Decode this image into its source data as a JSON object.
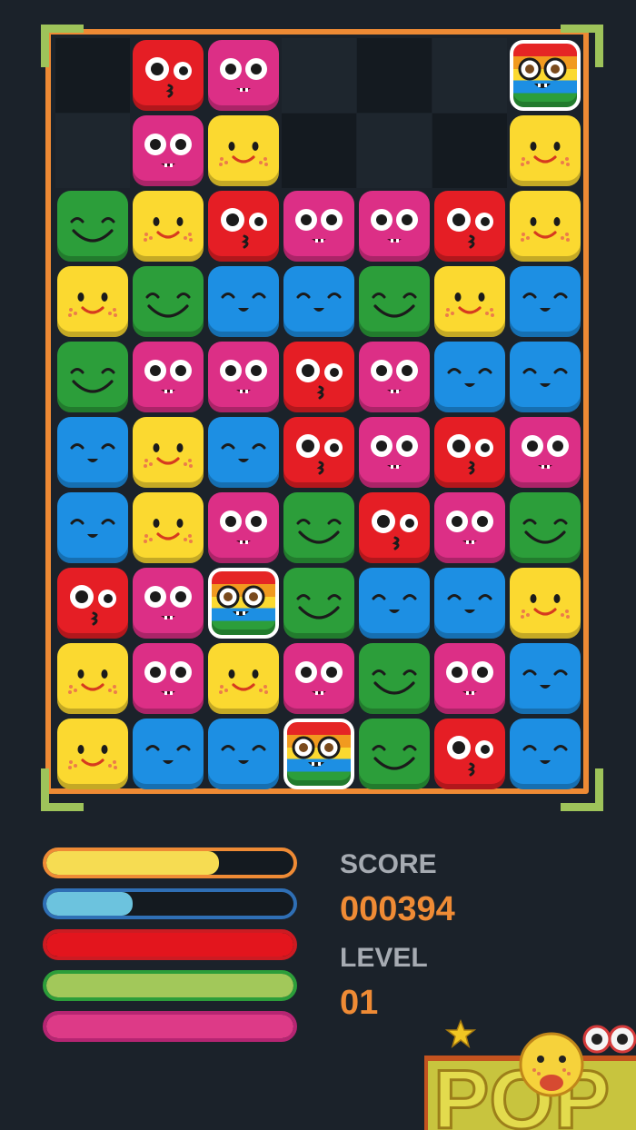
{
  "board": {
    "rows": [
      [
        "empty",
        "red",
        "pink",
        "empty",
        "empty",
        "empty",
        "rainbow"
      ],
      [
        "empty",
        "pink",
        "yellow",
        "empty",
        "empty",
        "empty",
        "yellow"
      ],
      [
        "green",
        "yellow",
        "red",
        "pink",
        "pink",
        "red",
        "yellow"
      ],
      [
        "yellow",
        "green",
        "blue",
        "blue",
        "green",
        "yellow",
        "blue"
      ],
      [
        "green",
        "pink",
        "pink",
        "red",
        "pink",
        "blue",
        "blue"
      ],
      [
        "blue",
        "yellow",
        "blue",
        "red",
        "pink",
        "red",
        "pink"
      ],
      [
        "blue",
        "yellow",
        "pink",
        "green",
        "red",
        "pink",
        "green"
      ],
      [
        "red",
        "pink",
        "rainbow",
        "green",
        "blue",
        "blue",
        "yellow"
      ],
      [
        "yellow",
        "pink",
        "yellow",
        "pink",
        "green",
        "pink",
        "blue"
      ],
      [
        "yellow",
        "blue",
        "blue",
        "rainbow",
        "green",
        "red",
        "blue"
      ]
    ]
  },
  "meters": [
    {
      "name": "yellow-meter",
      "border": "#ef8b35",
      "fill_color": "#f6dc52",
      "fill_fraction": 0.7
    },
    {
      "name": "blue-meter",
      "border": "#2f6fb5",
      "fill_color": "#6cc3de",
      "fill_fraction": 0.35
    },
    {
      "name": "red-meter",
      "border": "#cc1b22",
      "fill_color": "#e3151d",
      "fill_fraction": 1.0
    },
    {
      "name": "green-meter",
      "border": "#2c9e3a",
      "fill_color": "#a2c85a",
      "fill_fraction": 1.0
    },
    {
      "name": "pink-meter",
      "border": "#b52572",
      "fill_color": "#dd3a87",
      "fill_fraction": 1.0
    }
  ],
  "stats": {
    "score_label": "SCORE",
    "score_value": "000394",
    "level_label": "LEVEL",
    "level_value": "01"
  },
  "logo": {
    "text": "POP"
  },
  "colors": {
    "background": "#1b222a",
    "frame": "#ee8a34",
    "corner": "#9ec35a",
    "accent_text": "#ef8b35",
    "label_text": "#a6abb2"
  }
}
